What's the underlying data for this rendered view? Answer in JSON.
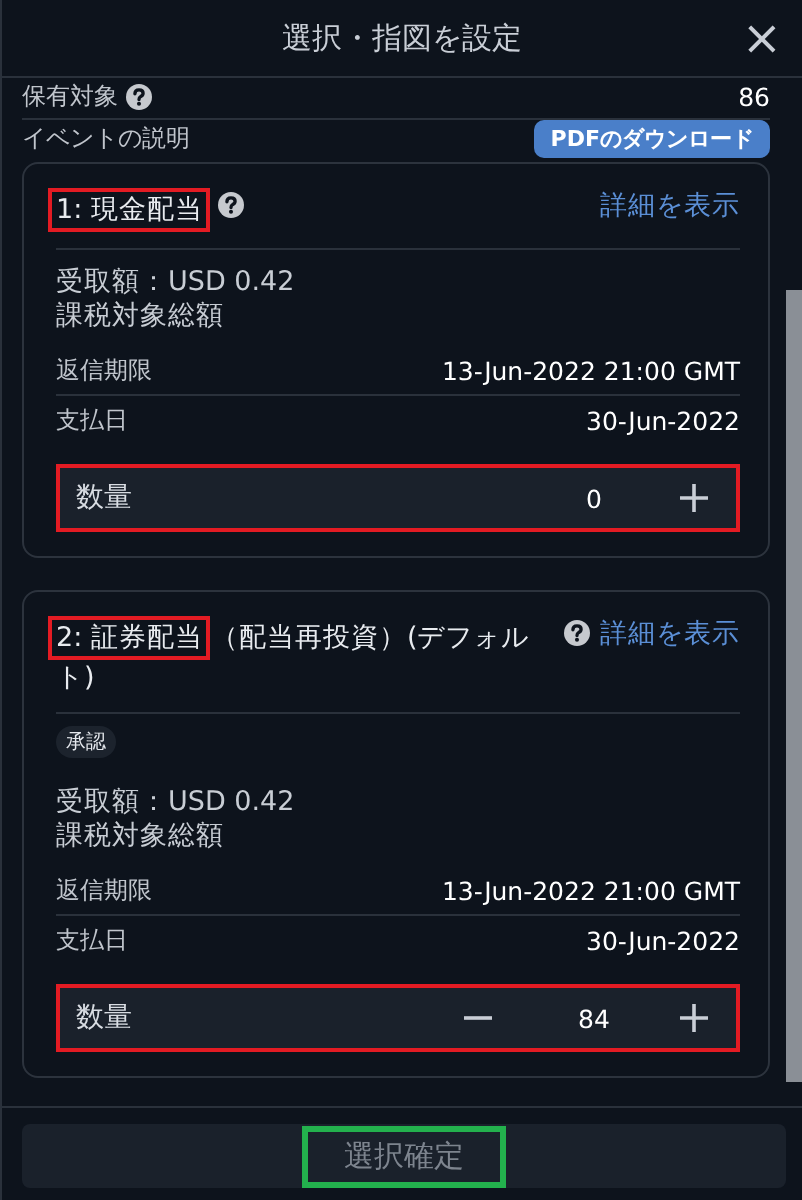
{
  "dialog": {
    "title": "選択・指図を設定",
    "close": "×"
  },
  "holding": {
    "label": "保有対象",
    "value": "86"
  },
  "event": {
    "label": "イベントの説明",
    "pdf_button": "PDFのダウンロード"
  },
  "options": [
    {
      "number": "1: 現金配当",
      "highlighted": true,
      "details_link": "詳細を表示",
      "amount": "受取額：USD 0.42",
      "amount_note": "課税対象総額",
      "rows": [
        {
          "label": "返信期限",
          "value": "13-Jun-2022 21:00 GMT"
        },
        {
          "label": "支払日",
          "value": "30-Jun-2022"
        }
      ],
      "quantity": {
        "label": "数量",
        "value": "0",
        "minus": false,
        "highlighted": true
      }
    },
    {
      "number": "2: 証券配当",
      "title_rest": "（配当再投資）(デフォルト)",
      "highlighted": true,
      "badge": "承認",
      "details_link": "詳細を表示",
      "amount": "受取額：USD 0.42",
      "amount_note": "課税対象総額",
      "rows": [
        {
          "label": "返信期限",
          "value": "13-Jun-2022 21:00 GMT"
        },
        {
          "label": "支払日",
          "value": "30-Jun-2022"
        }
      ],
      "quantity": {
        "label": "数量",
        "value": "84",
        "minus": true,
        "highlighted": true
      }
    }
  ],
  "confirm_button": {
    "label": "選択確定",
    "disabled": true,
    "highlighted": true
  }
}
